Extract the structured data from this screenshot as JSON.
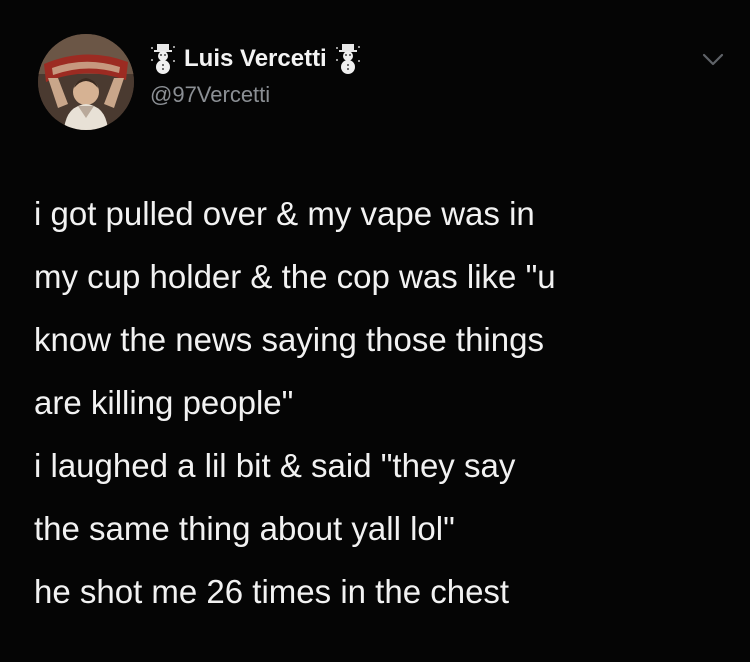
{
  "tweet": {
    "author": {
      "display_name": "Luis Vercetti",
      "handle": "@97Vercetti",
      "avatar_icon": "avatar-photo",
      "decoration_icon": "snowman-icon"
    },
    "menu_icon": "chevron-down-icon",
    "lines": [
      "i got pulled over & my vape was in",
      "my cup holder & the cop was like \"u",
      "know the news saying those things",
      "are killing people\"",
      "i laughed a lil bit & said \"they say",
      "the same thing about yall lol\"",
      "he shot me 26 times in the chest"
    ]
  },
  "colors": {
    "background": "#050505",
    "text": "#f2f2f2",
    "handle": "#8b8f94"
  }
}
